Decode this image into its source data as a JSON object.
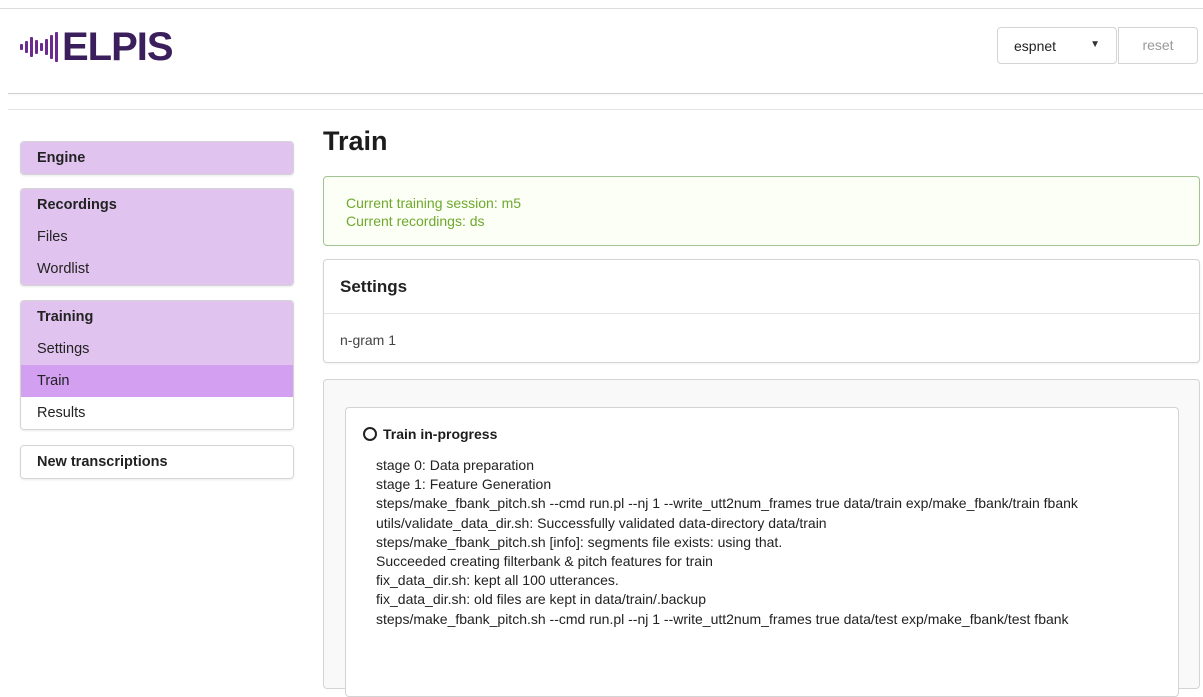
{
  "header": {
    "logo_text": "ELPIS",
    "engine_value": "espnet",
    "reset_label": "reset"
  },
  "sidebar": {
    "engine": "Engine",
    "recordings": {
      "label": "Recordings",
      "files": "Files",
      "wordlist": "Wordlist"
    },
    "training": {
      "label": "Training",
      "settings": "Settings",
      "train": "Train",
      "results": "Results"
    },
    "new_transcriptions": "New transcriptions"
  },
  "main": {
    "title": "Train",
    "message": {
      "session": "Current training session: m5",
      "recordings": "Current recordings: ds"
    },
    "settings": {
      "header": "Settings",
      "value": "n-gram 1"
    },
    "progress": {
      "title": "Train in-progress",
      "log": [
        "stage 0: Data preparation",
        "stage 1: Feature Generation",
        "steps/make_fbank_pitch.sh --cmd run.pl --nj 1 --write_utt2num_frames true data/train exp/make_fbank/train fbank",
        "utils/validate_data_dir.sh: Successfully validated data-directory data/train",
        "steps/make_fbank_pitch.sh [info]: segments file exists: using that.",
        "Succeeded creating filterbank & pitch features for train",
        "fix_data_dir.sh: kept all 100 utterances.",
        "fix_data_dir.sh: old files are kept in data/train/.backup",
        "steps/make_fbank_pitch.sh --cmd run.pl --nj 1 --write_utt2num_frames true data/test exp/make_fbank/test fbank"
      ]
    }
  },
  "colors": {
    "brand": "#3a1f5c",
    "menu_bg": "#e0c4ef",
    "menu_active": "#d39ff0",
    "success_text": "#6fa82e"
  }
}
